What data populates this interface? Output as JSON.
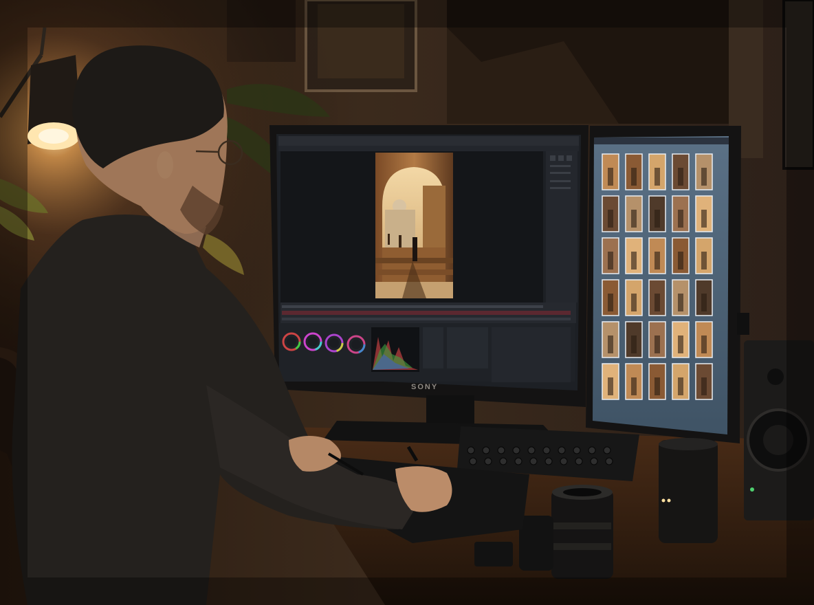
{
  "scene": {
    "kind": "photo",
    "colors": {
      "wall_dark": "#1b130d",
      "wall_warm": "#3a281a",
      "lamp_glow": "#ffcf85",
      "desk": "#3b2414",
      "monitor_bezel": "#141313",
      "ui_bg": "#1f2227",
      "ui_panel": "#2a2d33",
      "grid_bg": "#4c6175",
      "sweater": "#23201d"
    }
  },
  "left_monitor": {
    "brand": "SONY",
    "scopes": [
      {
        "name": "lift-wheel"
      },
      {
        "name": "gamma-wheel"
      },
      {
        "name": "gain-wheel"
      },
      {
        "name": "offset-wheel"
      }
    ]
  },
  "right_monitor": {
    "thumbnail_rows": 6,
    "thumbnail_cols": 5
  }
}
